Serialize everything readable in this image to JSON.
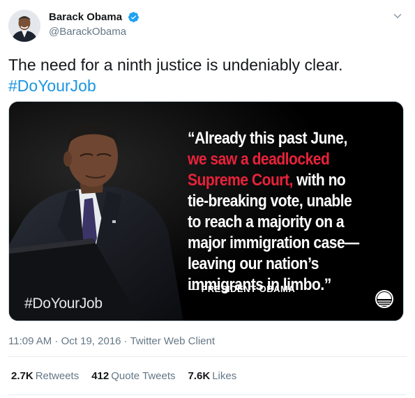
{
  "author": {
    "display_name": "Barack Obama",
    "handle": "@BarackObama",
    "verified": true
  },
  "icons": {
    "verified": "verified-badge-icon",
    "caret": "chevron-down-icon",
    "logo": "obama-rising-sun-logo-icon"
  },
  "tweet": {
    "text": "The need for a ninth justice is undeniably clear.",
    "hashtag": "#DoYourJob"
  },
  "media": {
    "quote_white_1": "“Already this past June, ",
    "quote_red": "we saw a deadlocked Supreme Court,",
    "quote_white_2": " with no tie-breaking vote, unable to reach a majority on a major immigration case—leaving our nation’s immigrants in limbo.”",
    "attribution": "— PRESIDENT OBAMA",
    "overlay_hashtag": "#DoYourJob"
  },
  "meta": {
    "time": "11:09 AM",
    "separator": " · ",
    "date": "Oct 19, 2016",
    "source": "Twitter Web Client"
  },
  "stats": {
    "retweets_count": "2.7K",
    "retweets_label": "Retweets",
    "quotes_count": "412",
    "quotes_label": "Quote Tweets",
    "likes_count": "7.6K",
    "likes_label": "Likes"
  },
  "colors": {
    "accent": "#1b95e0",
    "verified": "#1da1f2",
    "quote_red": "#e8223a",
    "muted": "#657786"
  }
}
